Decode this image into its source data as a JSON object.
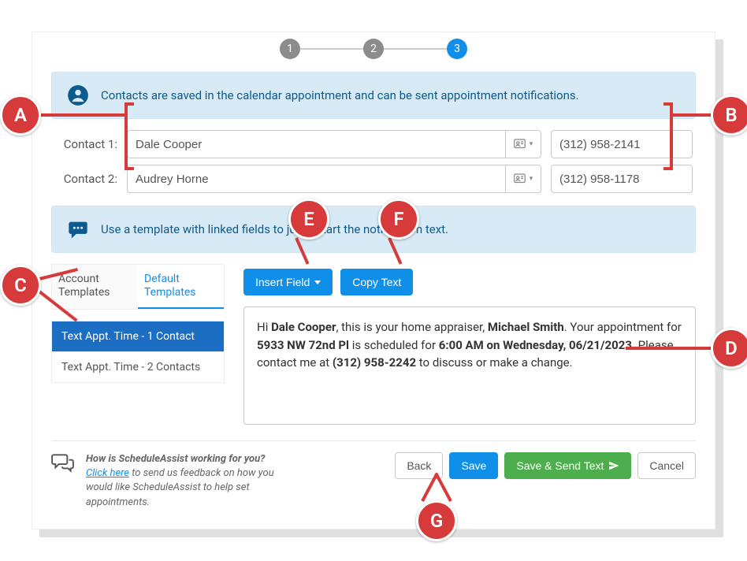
{
  "stepper": {
    "steps": [
      "1",
      "2",
      "3"
    ],
    "active_index": 2
  },
  "alert_contacts": "Contacts are saved in the calendar appointment and can be sent appointment notifications.",
  "alert_template": "Use a template with linked fields to jump-start the notification text.",
  "contacts": [
    {
      "label": "Contact 1:",
      "name": "Dale Cooper",
      "phone": "(312) 958-2141"
    },
    {
      "label": "Contact 2:",
      "name": "Audrey Horne",
      "phone": "(312) 958-1178"
    }
  ],
  "tabs": {
    "account": "Account Templates",
    "default": "Default Templates",
    "active": "default"
  },
  "templates": [
    {
      "label": "Text Appt. Time - 1 Contact",
      "selected": true
    },
    {
      "label": "Text Appt. Time - 2 Contacts",
      "selected": false
    }
  ],
  "buttons": {
    "insert_field": "Insert Field",
    "copy_text": "Copy Text",
    "back": "Back",
    "save": "Save",
    "save_send": "Save & Send Text",
    "cancel": "Cancel"
  },
  "message": {
    "prefix": "Hi ",
    "contact_name": "Dale Cooper",
    "t1": ", this is your home appraiser, ",
    "appraiser": "Michael Smith",
    "t2": ". Your appointment for ",
    "address": "5933 NW 72nd Pl",
    "t3": " is scheduled for ",
    "time": "6:00 AM on Wednesday, 06/21/2023",
    "t4": ". Please contact me at ",
    "phone": "(312) 958-2242",
    "t5": " to discuss or make a change."
  },
  "feedback": {
    "question": "How is ScheduleAssist working for you?",
    "link": "Click here",
    "rest": " to send us feedback on how you would like ScheduleAssist to help set appointments."
  },
  "annotations": {
    "A": "A",
    "B": "B",
    "C": "C",
    "D": "D",
    "E": "E",
    "F": "F",
    "G": "G"
  }
}
